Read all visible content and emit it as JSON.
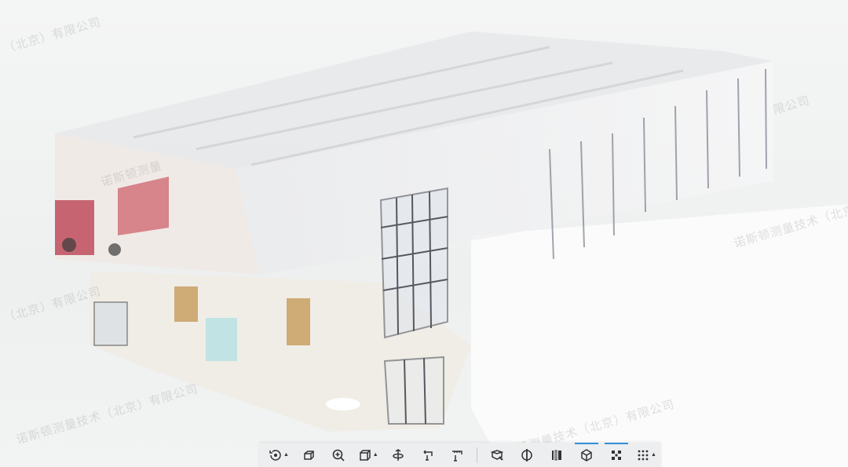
{
  "watermark": {
    "text_full": "诺斯顿测量技术（北京）有限公司",
    "text_partial_top": "（北京）有限公司",
    "text_partial_right": "限公司",
    "text_partial_left": "（北京）有限公司",
    "text_partial_mid": "诺斯顿测量"
  },
  "toolbar": {
    "tools": [
      {
        "name": "orbit-tool",
        "icon": "orbit-icon",
        "has_menu": true
      },
      {
        "name": "pan-tool",
        "icon": "box-move-icon",
        "has_menu": false
      },
      {
        "name": "zoom-tool",
        "icon": "zoom-icon",
        "has_menu": false
      },
      {
        "name": "view-cube-tool",
        "icon": "cube-outline-icon",
        "has_menu": true
      },
      {
        "name": "center-tool",
        "icon": "center-icon",
        "has_menu": false
      },
      {
        "name": "rotate-tool",
        "icon": "rotate-icon",
        "has_menu": false
      },
      {
        "name": "measure-tool",
        "icon": "measure-icon",
        "has_menu": false
      },
      {
        "name": "clip-tool",
        "icon": "clip-icon",
        "has_menu": false
      },
      {
        "name": "section-tool",
        "icon": "section-icon",
        "has_menu": false
      },
      {
        "name": "slice-tool",
        "icon": "slice-icon",
        "has_menu": false
      },
      {
        "name": "cube-solid-tool",
        "icon": "cube-solid-icon",
        "has_menu": false,
        "active": true
      },
      {
        "name": "points-tool",
        "icon": "points-icon",
        "has_menu": false,
        "active": true
      },
      {
        "name": "grid-tool",
        "icon": "grid-dots-icon",
        "has_menu": true
      }
    ],
    "caret_glyph": "▲",
    "colors": {
      "accent": "#2f8fd8",
      "icon": "#333333",
      "bar": "#ecedee"
    }
  }
}
